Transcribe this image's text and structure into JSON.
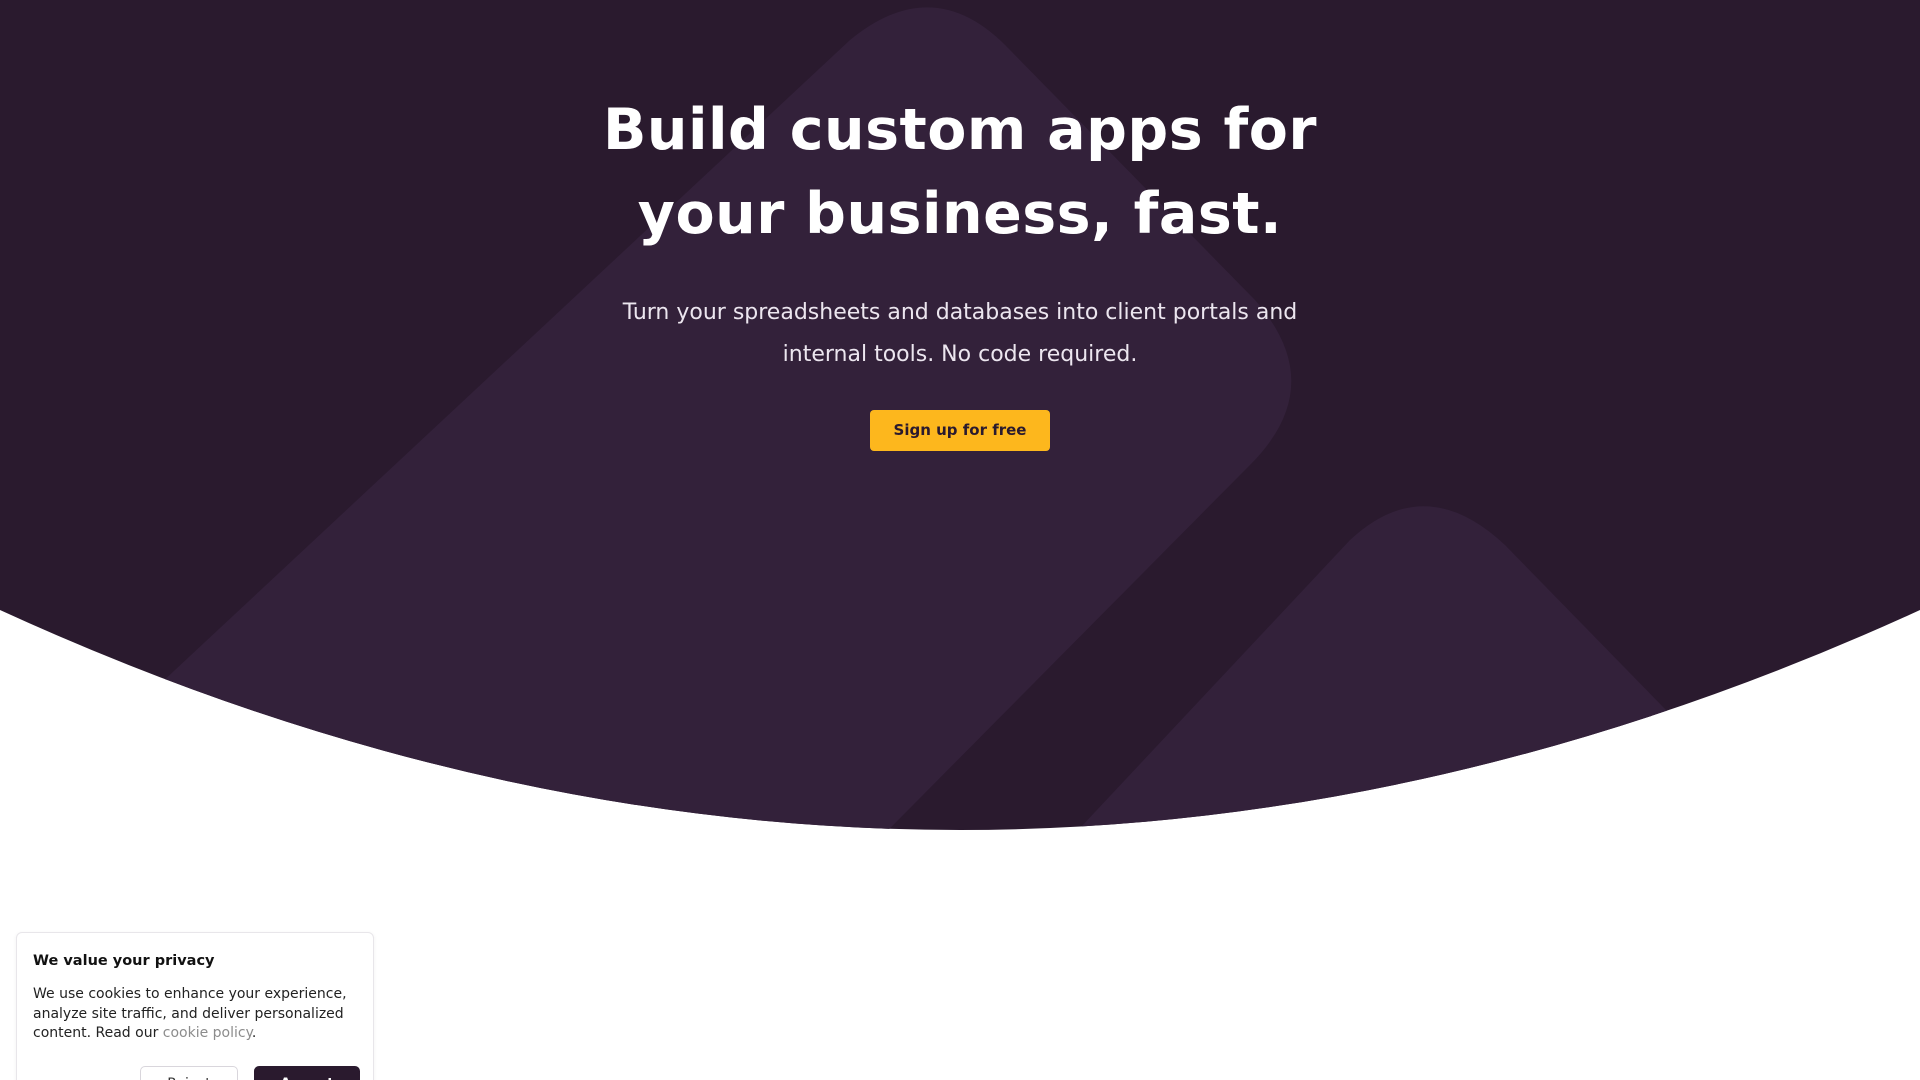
{
  "hero": {
    "title_line1": "Build custom apps for",
    "title_line2": "your business, fast.",
    "subtitle_line1": "Turn your spreadsheets and databases into client portals and",
    "subtitle_line2": "internal tools. No code required.",
    "cta_label": "Sign up for free"
  },
  "cookie_banner": {
    "title": "We value your privacy",
    "text": "We use cookies to enhance your experience, analyze site traffic, and deliver personalized content. Read our ",
    "link_label": "cookie policy",
    "text_end": ".",
    "reject_label": "Reject",
    "accept_label": "Accept"
  },
  "colors": {
    "hero_background": "#2a1a2e",
    "hero_shape": "#33213a",
    "cta_background": "#fdb71d",
    "accent_dark": "#2a1a2e"
  }
}
